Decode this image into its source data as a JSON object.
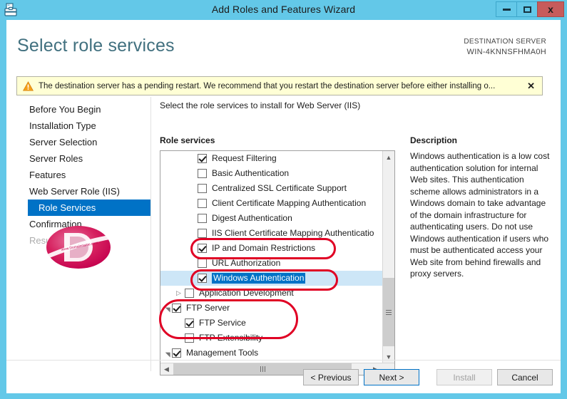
{
  "window": {
    "title": "Add Roles and Features Wizard",
    "icon": "server-wizard-icon",
    "minimize_label": "Minimize",
    "maximize_label": "Maximize",
    "close_label": "x",
    "accent_color": "#63c8e8",
    "close_color": "#c75b5b"
  },
  "header": {
    "page_title": "Select role services",
    "destination_label": "DESTINATION SERVER",
    "destination_server": "WIN-4KNNSFHMA0H",
    "title_color": "#41707f"
  },
  "warning": {
    "icon": "warning-triangle-icon",
    "text": "The destination server has a pending restart. We recommend that you restart the destination server before either installing o...",
    "close_label": "✕",
    "background": "#ffffd5"
  },
  "sidebar": {
    "items": [
      {
        "label": "Before You Begin",
        "state": "normal",
        "level": 0
      },
      {
        "label": "Installation Type",
        "state": "normal",
        "level": 0
      },
      {
        "label": "Server Selection",
        "state": "normal",
        "level": 0
      },
      {
        "label": "Server Roles",
        "state": "normal",
        "level": 0
      },
      {
        "label": "Features",
        "state": "normal",
        "level": 0
      },
      {
        "label": "Web Server Role (IIS)",
        "state": "normal",
        "level": 0
      },
      {
        "label": "Role Services",
        "state": "active",
        "level": 1
      },
      {
        "label": "Confirmation",
        "state": "normal",
        "level": 0
      },
      {
        "label": "Results",
        "state": "disabled",
        "level": 0
      }
    ],
    "active_background": "#0072c6",
    "logo": "d-oval-watermark-logo"
  },
  "main": {
    "subheading": "Select the role services to install for Web Server (IIS)",
    "role_services_label": "Role services",
    "description_label": "Description",
    "description_text": "Windows authentication is a low cost authentication solution for internal Web sites. This authentication scheme allows administrators in a Windows domain to take advantage of the domain infrastructure for authenticating users. Do not use Windows authentication if users who must be authenticated access your Web site from behind firewalls and proxy servers.",
    "role_services": [
      {
        "label": "Request Filtering",
        "checked": true,
        "indent": 2,
        "expander": "none",
        "selected": false
      },
      {
        "label": "Basic Authentication",
        "checked": false,
        "indent": 2,
        "expander": "none",
        "selected": false
      },
      {
        "label": "Centralized SSL Certificate Support",
        "checked": false,
        "indent": 2,
        "expander": "none",
        "selected": false
      },
      {
        "label": "Client Certificate Mapping Authentication",
        "checked": false,
        "indent": 2,
        "expander": "none",
        "selected": false
      },
      {
        "label": "Digest Authentication",
        "checked": false,
        "indent": 2,
        "expander": "none",
        "selected": false
      },
      {
        "label": "IIS Client Certificate Mapping Authenticatio",
        "checked": false,
        "indent": 2,
        "expander": "none",
        "selected": false
      },
      {
        "label": "IP and Domain Restrictions",
        "checked": true,
        "indent": 2,
        "expander": "none",
        "selected": false
      },
      {
        "label": "URL Authorization",
        "checked": false,
        "indent": 2,
        "expander": "none",
        "selected": false
      },
      {
        "label": "Windows Authentication",
        "checked": true,
        "indent": 2,
        "expander": "none",
        "selected": true
      },
      {
        "label": "Application Development",
        "checked": false,
        "indent": 1,
        "expander": "collapsed",
        "selected": false
      },
      {
        "label": "FTP Server",
        "checked": true,
        "indent": 0,
        "expander": "expanded",
        "selected": false
      },
      {
        "label": "FTP Service",
        "checked": true,
        "indent": 1,
        "expander": "none",
        "selected": false
      },
      {
        "label": "FTP Extensibility",
        "checked": false,
        "indent": 1,
        "expander": "none",
        "selected": false
      },
      {
        "label": "Management Tools",
        "checked": true,
        "indent": 0,
        "expander": "expanded",
        "selected": false
      }
    ],
    "selection_color": "#0072c6",
    "selected_row_background": "#cde6f7"
  },
  "annotations": {
    "color": "#e00024",
    "items": [
      {
        "name": "highlight-ip-and-domain-restrictions"
      },
      {
        "name": "highlight-windows-authentication"
      },
      {
        "name": "highlight-ftp-server-group"
      }
    ]
  },
  "footer": {
    "previous_label": "< Previous",
    "next_label": "Next >",
    "install_label": "Install",
    "cancel_label": "Cancel",
    "install_enabled": false,
    "next_focused": true
  }
}
